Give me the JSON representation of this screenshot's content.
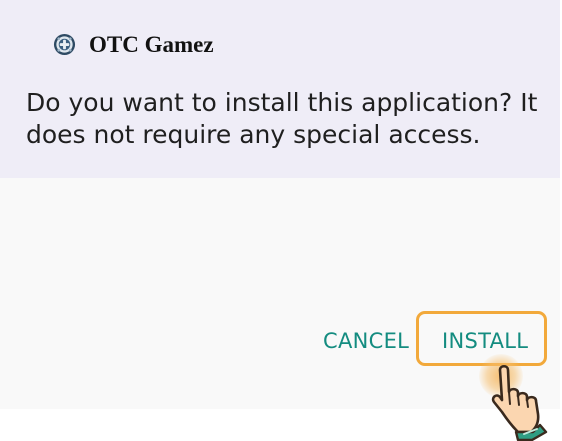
{
  "app": {
    "name": "OTC Gamez",
    "icon": "game-controller-icon"
  },
  "dialog": {
    "message_line1": "Do you want to install this application? It",
    "message_line2": "does not require any special access."
  },
  "actions": {
    "cancel_label": "CANCEL",
    "install_label": "INSTALL"
  },
  "pointer": {
    "icon": "pointing-hand-icon"
  },
  "colors": {
    "header_bg": "#efedf7",
    "body_bg": "#f9f9f9",
    "button_text": "#148c80",
    "highlight": "#f2a93b"
  }
}
